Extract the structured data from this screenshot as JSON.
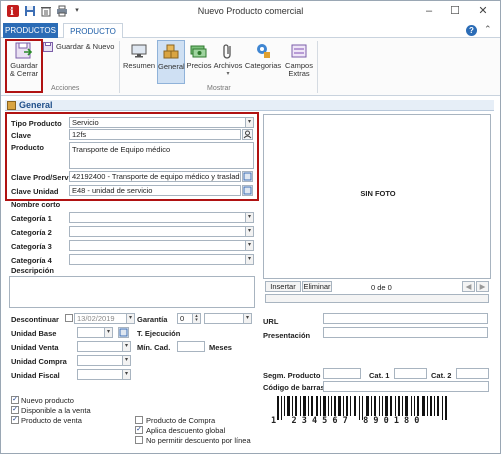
{
  "window": {
    "title": "Nuevo Producto comercial"
  },
  "tabs": {
    "file": "PRODUCTOS",
    "product": "PRODUCTO"
  },
  "ribbon": {
    "save_close": "Guardar & Cerrar",
    "save_new": "Guardar & Nuevo",
    "group_actions": "Acciones",
    "summary": "Resumen",
    "general": "General",
    "prices": "Precios",
    "files": "Archivos",
    "categories": "Categorias",
    "extra_fields": "Campos Extras",
    "group_show": "Mostrar"
  },
  "section": {
    "title": "General"
  },
  "form": {
    "product_type_label": "Tipo Producto",
    "product_type_value": "Servicio",
    "key_label": "Clave",
    "key_value": "12fs",
    "product_label": "Producto",
    "product_value": "Transporte de Equipo médico",
    "prod_serv_label": "Clave Prod/Serv",
    "prod_serv_value": "42192400 - Transporte de equipo médico y traslado de",
    "unit_key_label": "Clave Unidad",
    "unit_key_value": "E48 - unidad de servicio",
    "short_name_label": "Nombre corto",
    "cat1_label": "Categoría 1",
    "cat2_label": "Categoría 2",
    "cat3_label": "Categoría 3",
    "cat4_label": "Categoría 4",
    "description_label": "Descripción",
    "discontinue_label": "Descontinuar",
    "discontinue_date": "13/02/2019",
    "warranty_label": "Garantía",
    "warranty_value": "0",
    "base_unit_label": "Unidad Base",
    "exec_time_label": "T. Ejecución",
    "sale_unit_label": "Unidad Venta",
    "min_qty_label": "Mín. Cad.",
    "months_label": "Meses",
    "purchase_unit_label": "Unidad Compra",
    "fiscal_unit_label": "Unidad Fiscal"
  },
  "photo": {
    "label": "SIN FOTO",
    "insert": "Insertar",
    "delete": "Eliminar",
    "counter": "0 de 0"
  },
  "right": {
    "url_label": "URL",
    "presentation_label": "Presentación",
    "seg_label": "Segm. Producto",
    "cat1_label": "Cat. 1",
    "cat2_label": "Cat. 2",
    "barcode_label": "Código de barras",
    "barcode_digits": "1   2 3 4 5 6 7   8 9 0 1 8 0"
  },
  "checks": {
    "new_product": "Nuevo producto",
    "available": "Disponible a la venta",
    "for_sale": "Producto de venta",
    "for_purchase": "Producto de Compra",
    "global_discount": "Aplica descuento global",
    "no_line_discount": "No permitir descuento por línea"
  },
  "colors": {
    "accent": "#2b6cb6",
    "highlight": "#b01212"
  }
}
